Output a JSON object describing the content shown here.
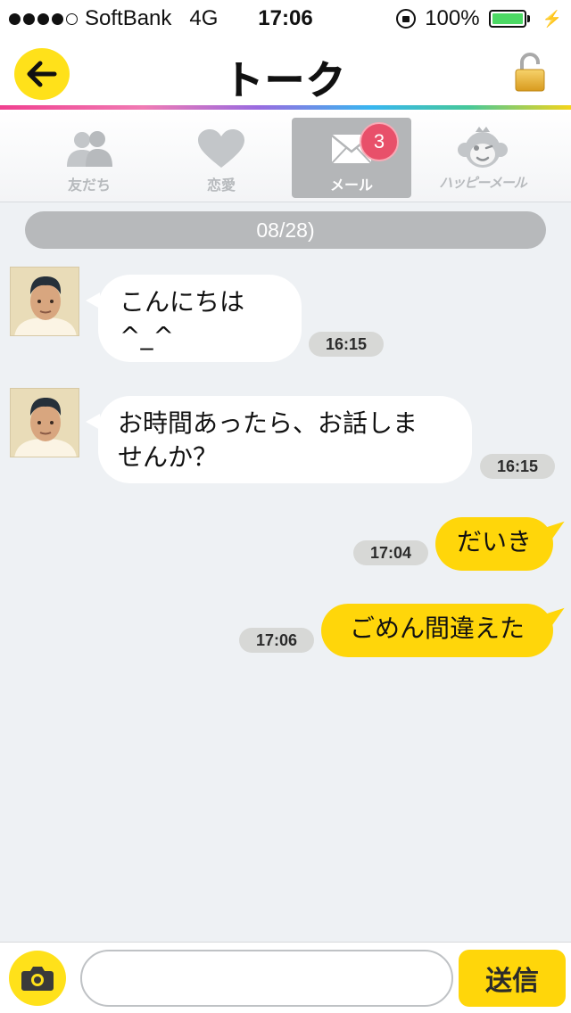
{
  "status_bar": {
    "carrier": "SoftBank",
    "network": "4G",
    "time": "17:06",
    "battery_percent": "100%",
    "battery_level": 1.0
  },
  "nav": {
    "title": "トーク"
  },
  "tabs": [
    {
      "label": "友だち",
      "icon": "people-icon",
      "active": false
    },
    {
      "label": "恋愛",
      "icon": "heart-icon",
      "active": false
    },
    {
      "label": "メール",
      "icon": "mail-icon",
      "active": true,
      "badge": "3"
    },
    {
      "label": "ハッピーメール",
      "icon": "monkey-mascot-icon",
      "active": false
    }
  ],
  "chat": {
    "date": "08/28)",
    "messages": [
      {
        "direction": "in",
        "lines": [
          "こんにちは",
          "^_^"
        ],
        "time": "16:15"
      },
      {
        "direction": "in",
        "lines": [
          "お時間あったら、お話しま",
          "せんか？"
        ],
        "time": "16:15"
      },
      {
        "direction": "out",
        "lines": [
          "だいき"
        ],
        "time": "17:04"
      },
      {
        "direction": "out",
        "lines": [
          "ごめん間違えた"
        ],
        "time": "17:06"
      }
    ]
  },
  "input": {
    "value": "",
    "send_label": "送信"
  },
  "colors": {
    "accent_yellow": "#ffd60a",
    "badge_red": "#e8506a",
    "chat_background": "#eef1f4"
  }
}
